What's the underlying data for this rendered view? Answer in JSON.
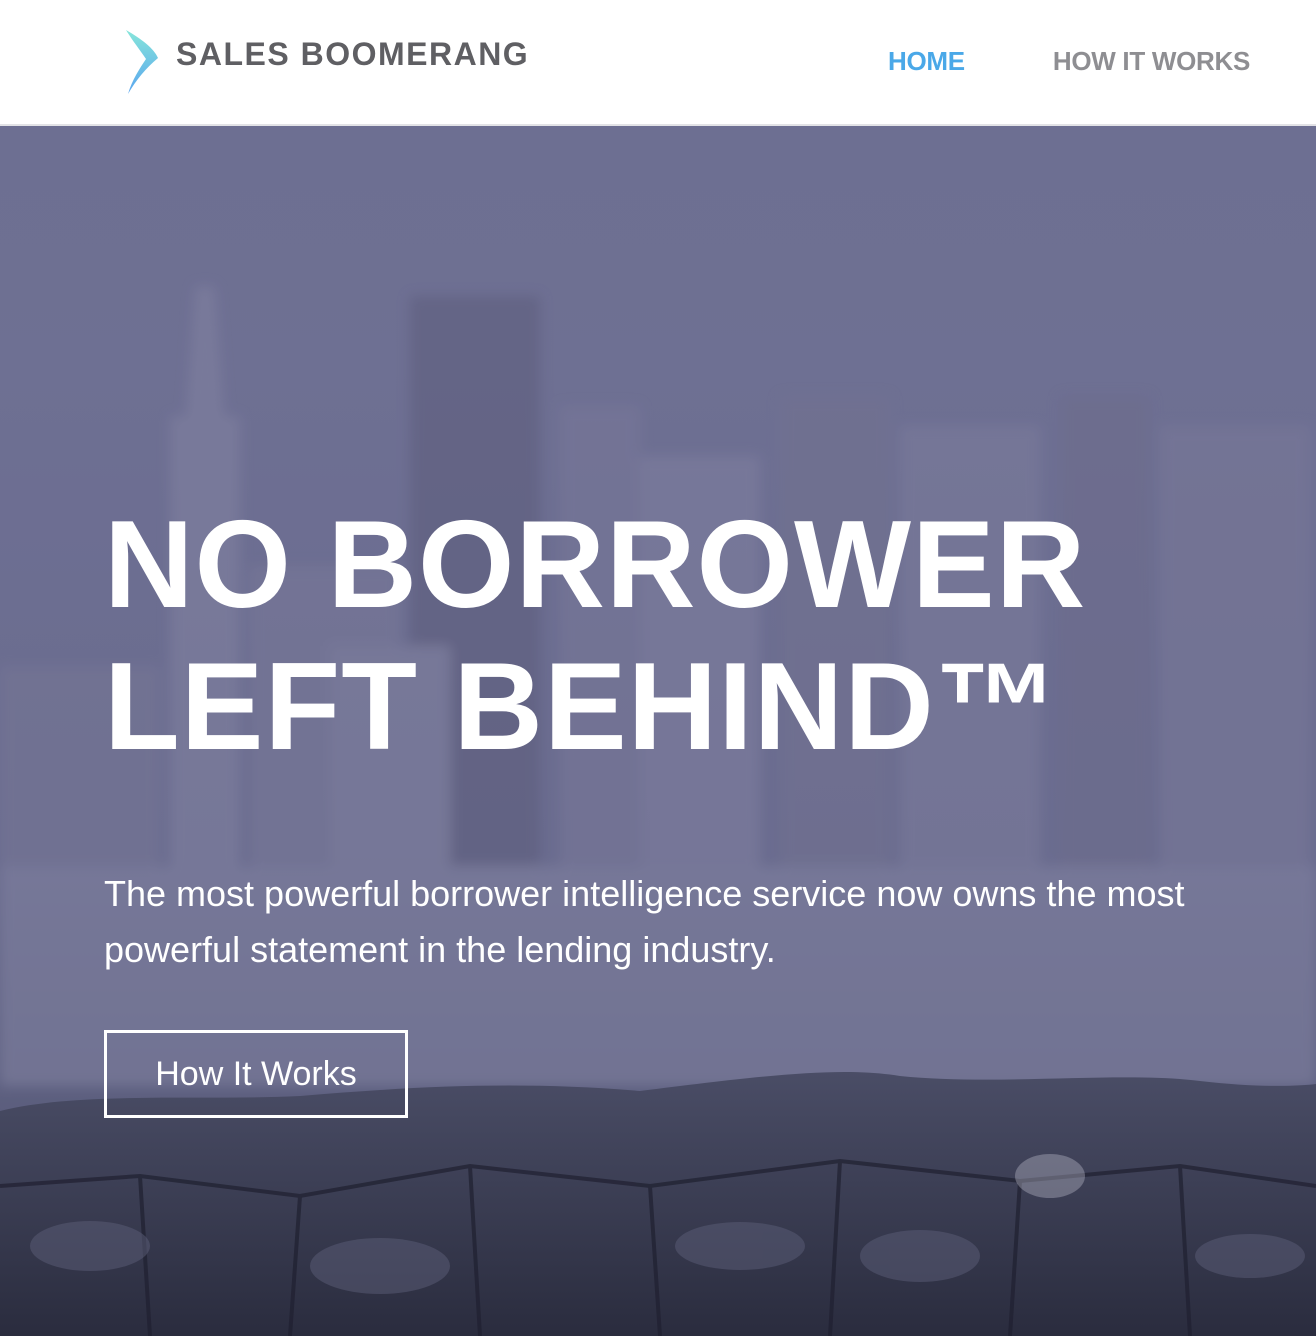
{
  "brand": {
    "name": "SALES BOOMERANG",
    "logo_icon": "boomerang-icon",
    "colors": {
      "logo_top": "#7fe0d8",
      "logo_bottom": "#5aa8ef",
      "text": "#5f5f63"
    }
  },
  "nav": {
    "items": [
      {
        "label": "HOME",
        "active": true,
        "color": "#4aa8e8"
      },
      {
        "label": "HOW IT WORKS",
        "active": false,
        "color": "#8e8e92"
      }
    ]
  },
  "hero": {
    "headline_line1": "NO BORROWER",
    "headline_line2": "LEFT BEHIND™",
    "subtext": "The most powerful borrower intelligence service now owns the most powerful statement in the lending industry.",
    "cta_label": "How It Works",
    "background": "blurred city skyline behind a stone wall",
    "overlay_color": "#6e6f92"
  }
}
